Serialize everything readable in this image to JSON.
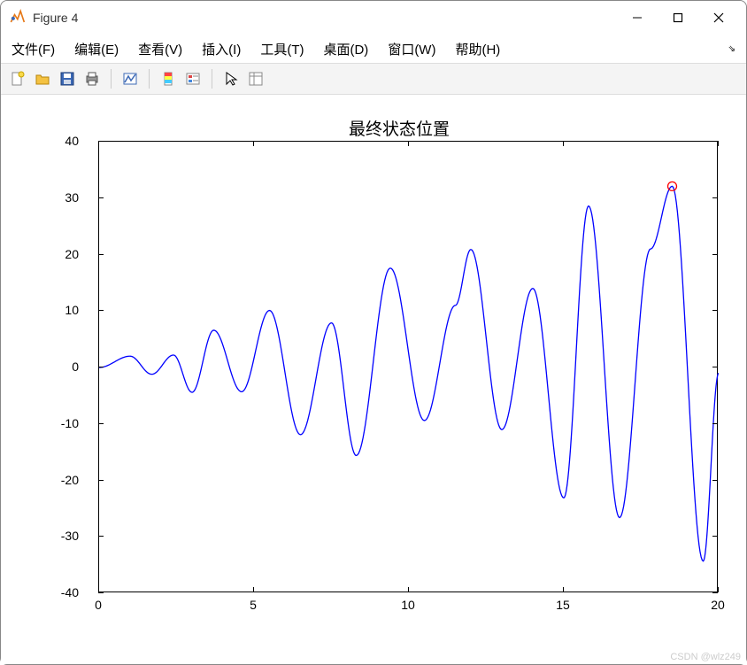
{
  "window": {
    "title": "Figure 4"
  },
  "menus": {
    "file": "文件(F)",
    "edit": "编辑(E)",
    "view": "查看(V)",
    "insert": "插入(I)",
    "tools": "工具(T)",
    "desktop": "桌面(D)",
    "window": "窗口(W)",
    "help": "帮助(H)"
  },
  "chart_data": {
    "type": "line",
    "title": "最终状态位置",
    "xlabel": "",
    "ylabel": "",
    "xlim": [
      0,
      20
    ],
    "ylim": [
      -40,
      40
    ],
    "xticks": [
      0,
      5,
      10,
      15,
      20
    ],
    "yticks": [
      -40,
      -30,
      -20,
      -10,
      0,
      10,
      20,
      30,
      40
    ],
    "series": [
      {
        "name": "line1",
        "color": "#0000ff",
        "oscillation_extrema": [
          {
            "x": 0.0,
            "y": 0.0
          },
          {
            "x": 1.0,
            "y": 2.0
          },
          {
            "x": 1.7,
            "y": -1.2
          },
          {
            "x": 2.4,
            "y": 2.2
          },
          {
            "x": 3.0,
            "y": -4.4
          },
          {
            "x": 3.7,
            "y": 6.6
          },
          {
            "x": 4.6,
            "y": -4.3
          },
          {
            "x": 5.5,
            "y": 10.1
          },
          {
            "x": 6.5,
            "y": -11.9
          },
          {
            "x": 7.5,
            "y": 7.9
          },
          {
            "x": 8.3,
            "y": -15.6
          },
          {
            "x": 9.4,
            "y": 17.6
          },
          {
            "x": 10.5,
            "y": -9.4
          },
          {
            "x": 11.5,
            "y": 11.0
          },
          {
            "x": 12.0,
            "y": 20.9
          },
          {
            "x": 13.0,
            "y": -11.0
          },
          {
            "x": 14.0,
            "y": 14.0
          },
          {
            "x": 15.0,
            "y": -23.1
          },
          {
            "x": 15.8,
            "y": 28.6
          },
          {
            "x": 16.8,
            "y": -26.6
          },
          {
            "x": 17.8,
            "y": 21.0
          },
          {
            "x": 18.5,
            "y": 32.1
          },
          {
            "x": 19.5,
            "y": -34.3
          },
          {
            "x": 20.0,
            "y": -1.0
          }
        ]
      }
    ],
    "markers": [
      {
        "x": 18.5,
        "y": 32.1,
        "shape": "circle",
        "edge": "#ff0000",
        "fill": "none"
      }
    ]
  },
  "watermark": "CSDN @wlz249"
}
